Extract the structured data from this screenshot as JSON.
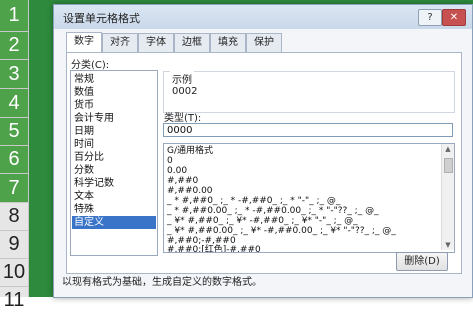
{
  "spreadsheet": {
    "rows": [
      "1",
      "2",
      "3",
      "4",
      "5",
      "6",
      "7",
      "8",
      "9",
      "10",
      "11"
    ],
    "selected_rows": [
      "1",
      "2",
      "3",
      "4",
      "5",
      "6",
      "7"
    ]
  },
  "dialog": {
    "title": "设置单元格格式",
    "titlebar_help": "?",
    "titlebar_close": "✕",
    "tabs": [
      "数字",
      "对齐",
      "字体",
      "边框",
      "填充",
      "保护"
    ],
    "active_tab": "数字",
    "category_label": "分类(C):",
    "categories": [
      "常规",
      "数值",
      "货币",
      "会计专用",
      "日期",
      "时间",
      "百分比",
      "分数",
      "科学记数",
      "文本",
      "特殊",
      "自定义"
    ],
    "selected_category": "自定义",
    "sample_label": "示例",
    "sample_value": "0002",
    "type_label": "类型(T):",
    "type_value": "0000",
    "formats": [
      "G/通用格式",
      "0",
      "0.00",
      "#,##0",
      "#,##0.00",
      "_ * #,##0_ ;_ * -#,##0_ ;_ * \"-\"_ ;_ @_",
      "_ * #,##0.00_ ;_ * -#,##0.00_ ;_ * \"-\"??_ ;_ @_",
      "_ ¥* #,##0_ ;_ ¥* -#,##0_ ;_ ¥* \"-\"_ ;_ @_",
      "_ ¥* #,##0.00_ ;_ ¥* -#,##0.00_ ;_ ¥* \"-\"??_ ;_ @_",
      "#,##0;-#,##0",
      "#,##0;[红色]-#,##0"
    ],
    "delete_button": "删除(D)",
    "hint": "以现有格式为基础，生成自定义的数字格式。"
  },
  "colors": {
    "excel_green": "#2e8b3d",
    "selection_blue": "#3a74c8"
  }
}
